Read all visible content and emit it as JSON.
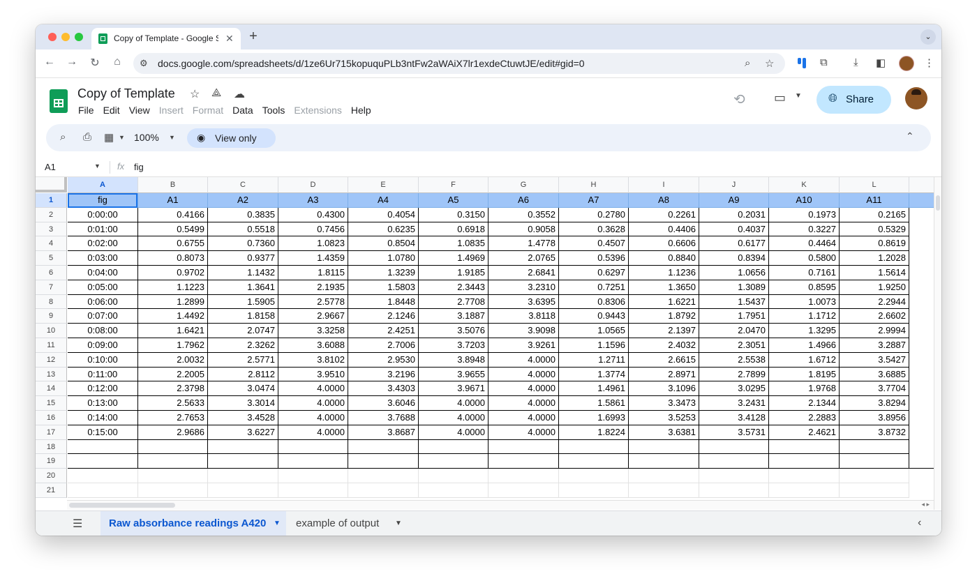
{
  "browser": {
    "tab_title": "Copy of Template - Google S",
    "url": "docs.google.com/spreadsheets/d/1ze6Ur715kopuquPLb3ntFw2aWAiX7lr1exdeCtuwtJE/edit#gid=0"
  },
  "doc": {
    "title": "Copy of Template",
    "share_label": "Share"
  },
  "menu": [
    {
      "label": "File",
      "enabled": true
    },
    {
      "label": "Edit",
      "enabled": true
    },
    {
      "label": "View",
      "enabled": true
    },
    {
      "label": "Insert",
      "enabled": false
    },
    {
      "label": "Format",
      "enabled": false
    },
    {
      "label": "Data",
      "enabled": true
    },
    {
      "label": "Tools",
      "enabled": true
    },
    {
      "label": "Extensions",
      "enabled": false
    },
    {
      "label": "Help",
      "enabled": true
    }
  ],
  "toolbar": {
    "zoom": "100%",
    "view_only_label": "View only"
  },
  "formula_bar": {
    "cell_ref": "A1",
    "fx": "fx",
    "value": "fig"
  },
  "grid": {
    "selected_column": "A",
    "selected_row": 1,
    "column_letters": [
      "A",
      "B",
      "C",
      "D",
      "E",
      "F",
      "G",
      "H",
      "I",
      "J",
      "K",
      "L"
    ],
    "row_numbers": [
      1,
      2,
      3,
      4,
      5,
      6,
      7,
      8,
      9,
      10,
      11,
      12,
      13,
      14,
      15,
      16,
      17,
      18,
      19,
      20,
      21
    ],
    "header_row": [
      "fig",
      "A1",
      "A2",
      "A3",
      "A4",
      "A5",
      "A6",
      "A7",
      "A8",
      "A9",
      "A10",
      "A11"
    ],
    "data_rows": [
      [
        "0:00:00",
        "0.4166",
        "0.3835",
        "0.4300",
        "0.4054",
        "0.3150",
        "0.3552",
        "0.2780",
        "0.2261",
        "0.2031",
        "0.1973",
        "0.2165"
      ],
      [
        "0:01:00",
        "0.5499",
        "0.5518",
        "0.7456",
        "0.6235",
        "0.6918",
        "0.9058",
        "0.3628",
        "0.4406",
        "0.4037",
        "0.3227",
        "0.5329"
      ],
      [
        "0:02:00",
        "0.6755",
        "0.7360",
        "1.0823",
        "0.8504",
        "1.0835",
        "1.4778",
        "0.4507",
        "0.6606",
        "0.6177",
        "0.4464",
        "0.8619"
      ],
      [
        "0:03:00",
        "0.8073",
        "0.9377",
        "1.4359",
        "1.0780",
        "1.4969",
        "2.0765",
        "0.5396",
        "0.8840",
        "0.8394",
        "0.5800",
        "1.2028"
      ],
      [
        "0:04:00",
        "0.9702",
        "1.1432",
        "1.8115",
        "1.3239",
        "1.9185",
        "2.6841",
        "0.6297",
        "1.1236",
        "1.0656",
        "0.7161",
        "1.5614"
      ],
      [
        "0:05:00",
        "1.1223",
        "1.3641",
        "2.1935",
        "1.5803",
        "2.3443",
        "3.2310",
        "0.7251",
        "1.3650",
        "1.3089",
        "0.8595",
        "1.9250"
      ],
      [
        "0:06:00",
        "1.2899",
        "1.5905",
        "2.5778",
        "1.8448",
        "2.7708",
        "3.6395",
        "0.8306",
        "1.6221",
        "1.5437",
        "1.0073",
        "2.2944"
      ],
      [
        "0:07:00",
        "1.4492",
        "1.8158",
        "2.9667",
        "2.1246",
        "3.1887",
        "3.8118",
        "0.9443",
        "1.8792",
        "1.7951",
        "1.1712",
        "2.6602"
      ],
      [
        "0:08:00",
        "1.6421",
        "2.0747",
        "3.3258",
        "2.4251",
        "3.5076",
        "3.9098",
        "1.0565",
        "2.1397",
        "2.0470",
        "1.3295",
        "2.9994"
      ],
      [
        "0:09:00",
        "1.7962",
        "2.3262",
        "3.6088",
        "2.7006",
        "3.7203",
        "3.9261",
        "1.1596",
        "2.4032",
        "2.3051",
        "1.4966",
        "3.2887"
      ],
      [
        "0:10:00",
        "2.0032",
        "2.5771",
        "3.8102",
        "2.9530",
        "3.8948",
        "4.0000",
        "1.2711",
        "2.6615",
        "2.5538",
        "1.6712",
        "3.5427"
      ],
      [
        "0:11:00",
        "2.2005",
        "2.8112",
        "3.9510",
        "3.2196",
        "3.9655",
        "4.0000",
        "1.3774",
        "2.8971",
        "2.7899",
        "1.8195",
        "3.6885"
      ],
      [
        "0:12:00",
        "2.3798",
        "3.0474",
        "4.0000",
        "3.4303",
        "3.9671",
        "4.0000",
        "1.4961",
        "3.1096",
        "3.0295",
        "1.9768",
        "3.7704"
      ],
      [
        "0:13:00",
        "2.5633",
        "3.3014",
        "4.0000",
        "3.6046",
        "4.0000",
        "4.0000",
        "1.5861",
        "3.3473",
        "3.2431",
        "2.1344",
        "3.8294"
      ],
      [
        "0:14:00",
        "2.7653",
        "3.4528",
        "4.0000",
        "3.7688",
        "4.0000",
        "4.0000",
        "1.6993",
        "3.5253",
        "3.4128",
        "2.2883",
        "3.8956"
      ],
      [
        "0:15:00",
        "2.9686",
        "3.6227",
        "4.0000",
        "3.8687",
        "4.0000",
        "4.0000",
        "1.8224",
        "3.6381",
        "3.5731",
        "2.4621",
        "3.8732"
      ]
    ]
  },
  "sheets": [
    {
      "name": "Raw absorbance readings A420",
      "active": true
    },
    {
      "name": "example of output",
      "active": false
    }
  ],
  "colors": {
    "header_fill": "#9fc5f8",
    "selection": "#1a73e8",
    "share_button": "#c2e7ff",
    "sheets_green": "#0f9d58"
  }
}
